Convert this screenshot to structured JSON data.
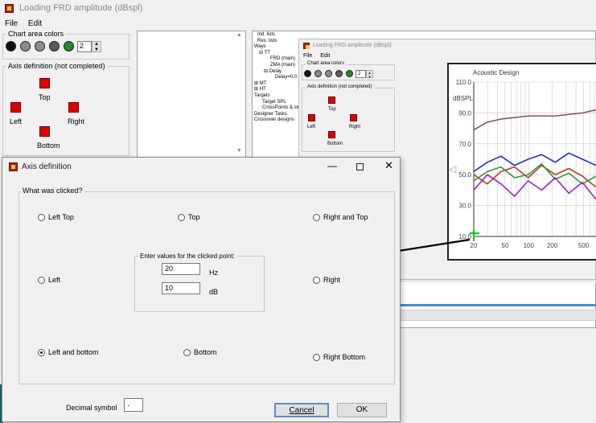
{
  "main_window": {
    "title": "Loading FRD amplitude (dBspl)",
    "menu": [
      "File",
      "Edit"
    ],
    "chart_area_colors_label": "Chart area colors",
    "color_swatches": [
      "#111111",
      "#8c8c8c",
      "#8c8c8c",
      "#5a5a5a",
      "#228b22"
    ],
    "spinner_value": "2",
    "axis_definition_label": "Axis definition (not completed)",
    "axis_buttons": {
      "top": "Top",
      "left": "Left",
      "right": "Right",
      "bottom": "Bottom"
    }
  },
  "tree": {
    "items": [
      "Ind. lists",
      "Res. lists",
      "Ways",
      "TT",
      "FRD (main)",
      "ZMA (main)",
      "Delay",
      "Delay=0.0",
      "MT",
      "HT",
      "Targets",
      "Target SPL",
      "CrossPoints & slop",
      "Designer Tasks",
      "Crossover designs"
    ]
  },
  "inner_window": {
    "title": "Loading FRD amplitude (dBspl)",
    "menu": [
      "File",
      "Edit"
    ],
    "chart_area_colors_label": "Chart area colors",
    "spinner_value": "2",
    "axis_definition_label": "Axis definition (not completed)",
    "axis_buttons": {
      "top": "Top",
      "left": "Left",
      "right": "Right",
      "bottom": "Bottom"
    }
  },
  "chart_data": {
    "type": "line",
    "title": "Acoustic Design",
    "ylabel": "dBSPL",
    "y_ticks": [
      "110.0",
      "90.0",
      "70.0",
      "50.0",
      "30.0",
      "10.0"
    ],
    "x_ticks": [
      "20",
      "50",
      "100",
      "200",
      "500"
    ],
    "ylim": [
      10,
      110
    ],
    "x_scale": "log",
    "grid": true,
    "series": [
      {
        "color": "#7a3b6e",
        "values": [
          79,
          84,
          86,
          87,
          88,
          88,
          88,
          89,
          90,
          92
        ]
      },
      {
        "color": "#1f2bd6",
        "values": [
          52,
          58,
          62,
          56,
          60,
          63,
          58,
          64,
          60,
          56
        ]
      },
      {
        "color": "#c0392b",
        "values": [
          50,
          44,
          52,
          55,
          48,
          56,
          50,
          54,
          49,
          42
        ]
      },
      {
        "color": "#2e9a3a",
        "values": [
          46,
          52,
          55,
          48,
          50,
          57,
          47,
          51,
          44,
          49
        ]
      },
      {
        "color": "#a020c0",
        "values": [
          40,
          50,
          44,
          36,
          46,
          40,
          48,
          38,
          45,
          34
        ]
      }
    ]
  },
  "dialog": {
    "title": "Axis definition",
    "group_label": "What was clicked?",
    "options": {
      "left_top": "Left Top",
      "top": "Top",
      "right_top": "Right and Top",
      "left": "Left",
      "right": "Right",
      "left_bottom": "Left and bottom",
      "bottom": "Bottom",
      "right_bottom": "Right Bottom"
    },
    "selected": "left_bottom",
    "values_group_label": "Enter values for the clicked point:",
    "hz_value": "20",
    "hz_unit": "Hz",
    "db_value": "10",
    "db_unit": "dB",
    "decimal_label": "Decimal symbol",
    "decimal_value": ".",
    "cancel_label": "Cancel",
    "ok_label": "OK"
  }
}
